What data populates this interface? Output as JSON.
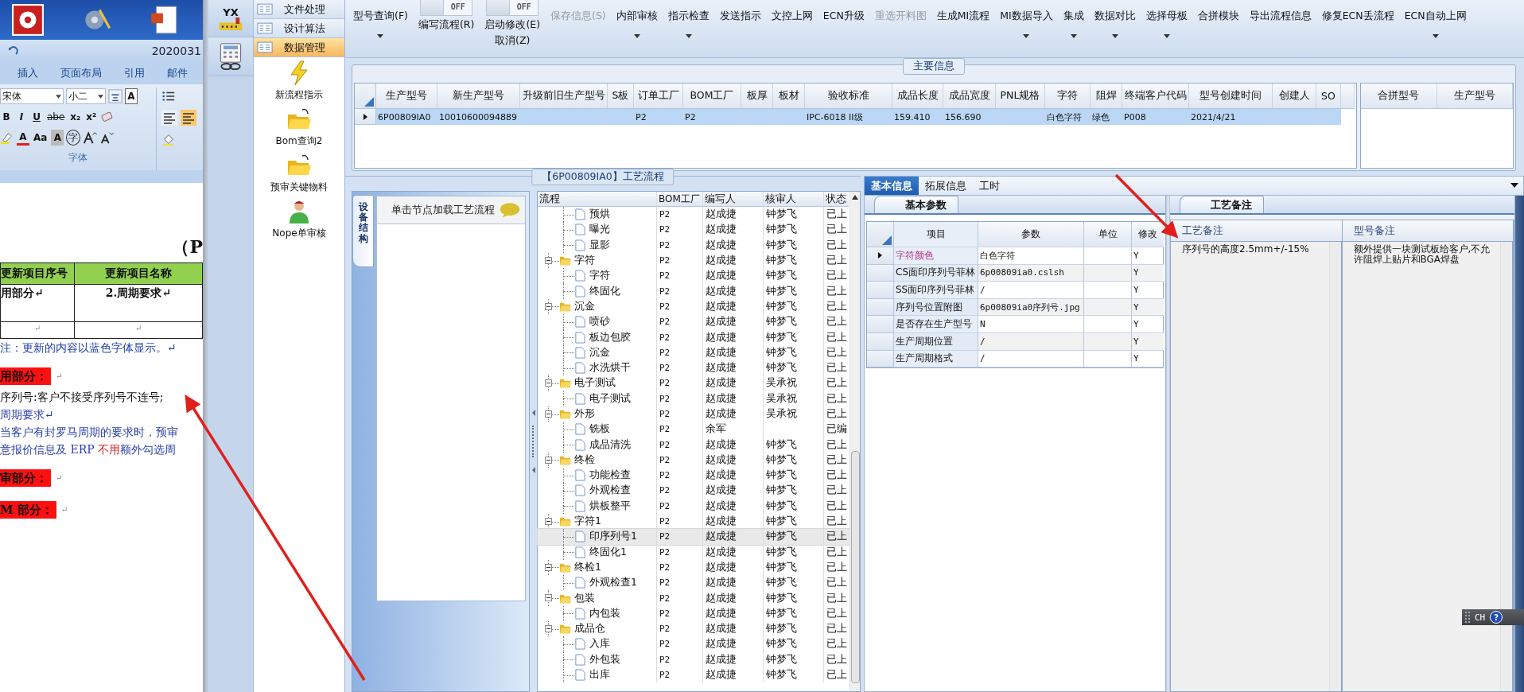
{
  "word": {
    "title": "2020031",
    "ribbon": {
      "tabs": [
        "插入",
        "页面布局",
        "引用",
        "邮件"
      ],
      "font": "宋体",
      "size": "小二",
      "row1_buttons": [
        "A"
      ],
      "row2_buttons": [
        "B",
        "I",
        "U",
        "abe",
        "x₂",
        "x²"
      ],
      "row3_buttons": [
        "A",
        "Aa",
        "A",
        "字"
      ],
      "group_label": "字体",
      "align_buttons": [
        {
          "selected": false
        },
        {
          "selected": true
        }
      ]
    },
    "document": {
      "title": "（P",
      "table": {
        "header": [
          "更新项目序号",
          "更新项目名称"
        ],
        "rows": [
          [
            "用部分↵",
            "2.周期要求↵"
          ],
          [
            "↵",
            "↵"
          ]
        ]
      },
      "lines": [
        {
          "kind": "note",
          "text": "注：更新的内容以蓝色字体显示。↵"
        },
        {
          "kind": "heading",
          "text": "用部分：",
          "mark": "↵"
        },
        {
          "kind": "body",
          "text": "序列号:客户不接受序列号不连号;"
        },
        {
          "kind": "blue",
          "text": "周期要求↵"
        },
        {
          "kind": "blue",
          "text": "当客户有封罗马周期的要求时，预审"
        },
        {
          "kind": "blue",
          "parts": [
            {
              "text": "意报价信息及 ERP ",
              "red": false
            },
            {
              "text": "不用",
              "red": true
            },
            {
              "text": "额外勾选周",
              "red": false
            }
          ]
        },
        {
          "kind": "heading",
          "text": "审部分：",
          "mark": "↵"
        },
        {
          "kind": "heading",
          "text": "M 部分：",
          "mark": "↵"
        }
      ]
    }
  },
  "app": {
    "logo": "YX",
    "sidebar": {
      "nav": [
        {
          "label": "文件处理",
          "selected": false
        },
        {
          "label": "设计算法",
          "selected": false
        },
        {
          "label": "数据管理",
          "selected": true
        }
      ],
      "items": [
        {
          "kind": "lightning",
          "label": "新流程指示"
        },
        {
          "kind": "folder",
          "label": "Bom查询2"
        },
        {
          "kind": "folder",
          "label": "预审关键物料"
        },
        {
          "kind": "person",
          "label": "Nope单审核"
        }
      ]
    },
    "toolbar": [
      {
        "kind": "button",
        "label": "型号查询(F)",
        "dropdown": true,
        "disabled": false
      },
      {
        "kind": "toggle",
        "switch_text": "OFF",
        "on": false,
        "label": "编写流程(R)"
      },
      {
        "kind": "toggle",
        "switch_text": "OFF",
        "on": false,
        "label": "启动修改(E)",
        "sublabel": "取消(Z)"
      },
      {
        "kind": "button",
        "label": "保存信息(S)",
        "dropdown": false,
        "disabled": true
      },
      {
        "kind": "button",
        "label": "内部审核",
        "dropdown": true,
        "disabled": false
      },
      {
        "kind": "button",
        "label": "指示检查",
        "dropdown": true,
        "disabled": false
      },
      {
        "kind": "button",
        "label": "发送指示",
        "dropdown": false,
        "disabled": false
      },
      {
        "kind": "button",
        "label": "文控上网",
        "dropdown": false,
        "disabled": false
      },
      {
        "kind": "button",
        "label": "ECN升级",
        "dropdown": false,
        "disabled": false
      },
      {
        "kind": "button",
        "label": "重选开料图",
        "dropdown": false,
        "disabled": true
      },
      {
        "kind": "button",
        "label": "生成MI流程",
        "dropdown": false,
        "disabled": false
      },
      {
        "kind": "button",
        "label": "MI数据导入",
        "dropdown": true,
        "disabled": false
      },
      {
        "kind": "button",
        "label": "集成",
        "dropdown": true,
        "disabled": false
      },
      {
        "kind": "button",
        "label": "数据对比",
        "dropdown": true,
        "disabled": false
      },
      {
        "kind": "button",
        "label": "选择母板",
        "dropdown": true,
        "disabled": false
      },
      {
        "kind": "button",
        "label": "合拼模块",
        "dropdown": false,
        "disabled": false
      },
      {
        "kind": "button",
        "label": "导出流程信息",
        "dropdown": false,
        "disabled": false
      },
      {
        "kind": "button",
        "label": "修复ECN丢流程",
        "dropdown": false,
        "disabled": false
      },
      {
        "kind": "button",
        "label": "ECN自动上网",
        "dropdown": true,
        "disabled": false
      }
    ],
    "main_info": {
      "title": "主要信息",
      "columns": [
        "生产型号",
        "新生产型号",
        "升级前旧生产型号",
        "S板",
        "订单工厂",
        "BOM工厂",
        "板厚",
        "板材",
        "验收标准",
        "成品长度",
        "成品宽度",
        "PNL规格",
        "字符",
        "阻焊",
        "终端客户代码",
        "型号创建时间",
        "创建人",
        "SO"
      ],
      "rows": [
        {
          "selected": true,
          "cells": [
            "6P00809IA0",
            "10010600094889",
            null,
            null,
            "P2",
            "P2",
            null,
            null,
            "IPC-6018 II级",
            "159.410",
            "156.690",
            null,
            "白色字符",
            "绿色",
            "P008",
            "2021/4/21",
            null,
            null
          ]
        }
      ],
      "side_columns": [
        "合拼型号",
        "生产型号"
      ]
    },
    "flow": {
      "title": "【6P00809IA0】工艺流程",
      "side_tab": "设备结构",
      "hint": "单击节点加载工艺流程",
      "columns": [
        "流程",
        "BOM工厂",
        "编写人",
        "核审人",
        "状态"
      ],
      "tree": [
        {
          "children": [
            {
              "name": "预烘",
              "bom": "P2",
              "writer": "赵成捷",
              "reviewer": "钟梦飞",
              "status": "已上",
              "selected": false
            },
            {
              "name": "曝光",
              "bom": "P2",
              "writer": "赵成捷",
              "reviewer": "钟梦飞",
              "status": "已上",
              "selected": false
            },
            {
              "name": "显影",
              "bom": "P2",
              "writer": "赵成捷",
              "reviewer": "钟梦飞",
              "status": "已上",
              "selected": false
            }
          ]
        },
        {
          "name": "字符",
          "bom": "P2",
          "writer": "赵成捷",
          "reviewer": "钟梦飞",
          "status": "已上",
          "selected": false,
          "expanded": true,
          "children": [
            {
              "name": "字符",
              "bom": "P2",
              "writer": "赵成捷",
              "reviewer": "钟梦飞",
              "status": "已上",
              "selected": false
            },
            {
              "name": "终固化",
              "bom": "P2",
              "writer": "赵成捷",
              "reviewer": "钟梦飞",
              "status": "已上",
              "selected": false
            }
          ]
        },
        {
          "name": "沉金",
          "bom": "P2",
          "writer": "赵成捷",
          "reviewer": "钟梦飞",
          "status": "已上",
          "selected": false,
          "expanded": true,
          "children": [
            {
              "name": "喷砂",
              "bom": "P2",
              "writer": "赵成捷",
              "reviewer": "钟梦飞",
              "status": "已上",
              "selected": false
            },
            {
              "name": "板边包胶",
              "bom": "P2",
              "writer": "赵成捷",
              "reviewer": "钟梦飞",
              "status": "已上",
              "selected": false
            },
            {
              "name": "沉金",
              "bom": "P2",
              "writer": "赵成捷",
              "reviewer": "钟梦飞",
              "status": "已上",
              "selected": false
            },
            {
              "name": "水洗烘干",
              "bom": "P2",
              "writer": "赵成捷",
              "reviewer": "钟梦飞",
              "status": "已上",
              "selected": false
            }
          ]
        },
        {
          "name": "电子测试",
          "bom": "P2",
          "writer": "赵成捷",
          "reviewer": "吴承祝",
          "status": "已上",
          "selected": false,
          "expanded": true,
          "children": [
            {
              "name": "电子测试",
              "bom": "P2",
              "writer": "赵成捷",
              "reviewer": "吴承祝",
              "status": "已上",
              "selected": false
            }
          ]
        },
        {
          "name": "外形",
          "bom": "P2",
          "writer": "赵成捷",
          "reviewer": "吴承祝",
          "status": "已上",
          "selected": false,
          "expanded": true,
          "children": [
            {
              "name": "铣板",
              "bom": "P2",
              "writer": "余军",
              "status": "已编",
              "selected": false
            },
            {
              "name": "成品清洗",
              "bom": "P2",
              "writer": "赵成捷",
              "reviewer": "钟梦飞",
              "status": "已上",
              "selected": false
            }
          ]
        },
        {
          "name": "终检",
          "bom": "P2",
          "writer": "赵成捷",
          "reviewer": "钟梦飞",
          "status": "已上",
          "selected": false,
          "expanded": true,
          "children": [
            {
              "name": "功能检查",
              "bom": "P2",
              "writer": "赵成捷",
              "reviewer": "钟梦飞",
              "status": "已上",
              "selected": false
            },
            {
              "name": "外观检查",
              "bom": "P2",
              "writer": "赵成捷",
              "reviewer": "钟梦飞",
              "status": "已上",
              "selected": false
            },
            {
              "name": "烘板整平",
              "bom": "P2",
              "writer": "赵成捷",
              "reviewer": "钟梦飞",
              "status": "已上",
              "selected": false
            }
          ]
        },
        {
          "name": "字符1",
          "bom": "P2",
          "writer": "赵成捷",
          "reviewer": "钟梦飞",
          "status": "已上",
          "selected": false,
          "expanded": true,
          "children": [
            {
              "name": "印序列号1",
              "bom": "P2",
              "writer": "赵成捷",
              "reviewer": "钟梦飞",
              "status": "已上",
              "selected": true
            },
            {
              "name": "终固化1",
              "bom": "P2",
              "writer": "赵成捷",
              "reviewer": "钟梦飞",
              "status": "已上",
              "selected": false
            }
          ]
        },
        {
          "name": "终检1",
          "bom": "P2",
          "writer": "赵成捷",
          "reviewer": "钟梦飞",
          "status": "已上",
          "selected": false,
          "expanded": true,
          "children": [
            {
              "name": "外观检查1",
              "bom": "P2",
              "writer": "赵成捷",
              "reviewer": "钟梦飞",
              "status": "已上",
              "selected": false
            }
          ]
        },
        {
          "name": "包装",
          "bom": "P2",
          "writer": "赵成捷",
          "reviewer": "钟梦飞",
          "status": "已上",
          "selected": false,
          "expanded": true,
          "children": [
            {
              "name": "内包装",
              "bom": "P2",
              "writer": "赵成捷",
              "reviewer": "钟梦飞",
              "status": "已上",
              "selected": false
            }
          ]
        },
        {
          "name": "成品仓",
          "bom": "P2",
          "writer": "赵成捷",
          "reviewer": "钟梦飞",
          "status": "已上",
          "selected": false,
          "expanded": true,
          "children": [
            {
              "name": "入库",
              "bom": "P2",
              "writer": "赵成捷",
              "reviewer": "钟梦飞",
              "status": "已上",
              "selected": false
            },
            {
              "name": "外包装",
              "bom": "P2",
              "writer": "赵成捷",
              "reviewer": "钟梦飞",
              "status": "已上",
              "selected": false
            },
            {
              "name": "出库",
              "bom": "P2",
              "writer": "赵成捷",
              "reviewer": "钟梦飞",
              "status": "已上",
              "selected": false
            }
          ]
        }
      ]
    },
    "detail": {
      "tabs": [
        {
          "label": "基本信息",
          "selected": true
        },
        {
          "label": "拓展信息",
          "selected": false
        },
        {
          "label": "工时",
          "selected": false
        }
      ],
      "params": {
        "tab": "基本参数",
        "columns": [
          "项目",
          "参数",
          "单位",
          "修改"
        ],
        "rows": [
          {
            "item": "字符颜色",
            "value": "白色字符",
            "modified": "Y",
            "selected": true,
            "highlighted": true
          },
          {
            "item": "CS面印序列号菲林",
            "value": "6p00809ia0.cslsh",
            "modified": "Y",
            "selected": false,
            "highlighted": false
          },
          {
            "item": "SS面印序列号菲林",
            "value": "/",
            "modified": "Y",
            "selected": false,
            "highlighted": false
          },
          {
            "item": "序列号位置附图",
            "value": "6p00809ia0序列号.jpg",
            "modified": "Y",
            "selected": false,
            "highlighted": false
          },
          {
            "item": "是否存在生产型号",
            "value": "N",
            "modified": "Y",
            "selected": false,
            "highlighted": false
          },
          {
            "item": "生产周期位置",
            "value": "/",
            "modified": "Y",
            "selected": false,
            "highlighted": false
          },
          {
            "item": "生产周期格式",
            "value": "/",
            "modified": "Y",
            "selected": false,
            "highlighted": false
          }
        ]
      },
      "notes": {
        "tab": "工艺备注",
        "columns": [
          "工艺备注",
          "型号备注"
        ],
        "values": [
          "序列号的高度2.5mm+/-15%",
          "额外提供一块测试板给客户,不允许阻焊上贴片和BGA焊盘"
        ]
      }
    }
  },
  "language_bar": {
    "code": "CH",
    "help": "?"
  }
}
